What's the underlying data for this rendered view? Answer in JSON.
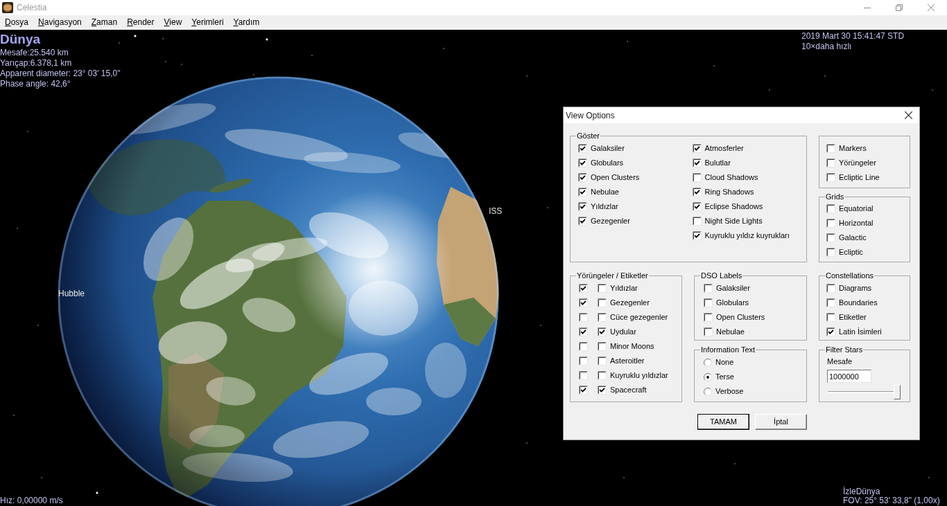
{
  "window": {
    "title": "Celestia"
  },
  "menu": [
    "Dosya",
    "Navigasyon",
    "Zaman",
    "Render",
    "View",
    "Yerimleri",
    "Yardım"
  ],
  "hud": {
    "object_name": "Dünya",
    "details": [
      "Mesafe:25.540 km",
      "Yarıçap:6.378,1 km",
      "Apparent diameter: 23° 03' 15,0\"",
      "Phase angle: 42,6°"
    ],
    "date_time": "2019 Mart 30 15:41:47 STD",
    "time_rate": "10×daha hızlı",
    "speed": "Hız: 0,00000 m/s",
    "tracking": "İzleDünya",
    "fov": "FOV: 25° 53' 33,8\" (1,00x)"
  },
  "scene_labels": [
    {
      "text": "ISS"
    },
    {
      "text": "Hubble"
    }
  ],
  "view_options": {
    "title": "View Options",
    "show": {
      "title": "Göster",
      "columns": [
        {
          "items": [
            {
              "label": "Galaksiler",
              "checked": true
            },
            {
              "label": "Globulars",
              "checked": true
            },
            {
              "label": "Open Clusters",
              "checked": true
            },
            {
              "label": "Nebulae",
              "checked": true
            },
            {
              "label": "Yıldızlar",
              "checked": true
            },
            {
              "label": "Gezegenler",
              "checked": true
            }
          ]
        },
        {
          "items": [
            {
              "label": "Atmosferler",
              "checked": true
            },
            {
              "label": "Bulutlar",
              "checked": true
            },
            {
              "label": "Cloud Shadows",
              "checked": false
            },
            {
              "label": "Ring Shadows",
              "checked": true
            },
            {
              "label": "Eclipse Shadows",
              "checked": true
            },
            {
              "label": "Night Side Lights",
              "checked": false
            },
            {
              "label": "Kuyruklu yıldız kuyrukları",
              "checked": true
            }
          ]
        }
      ]
    },
    "untitled_group": {
      "items": [
        {
          "label": "Markers",
          "checked": false
        },
        {
          "label": "Yörüngeler",
          "checked": false
        },
        {
          "label": "Ecliptic Line",
          "checked": false
        }
      ]
    },
    "grids": {
      "title": "Grids",
      "items": [
        {
          "label": "Equatorial",
          "checked": false
        },
        {
          "label": "Horizontal",
          "checked": false
        },
        {
          "label": "Galactic",
          "checked": false
        },
        {
          "label": "Ecliptic",
          "checked": false
        }
      ]
    },
    "orbits_labels": {
      "title": "Yörüngeler / Etiketler",
      "rows": [
        {
          "label": "Yıldızlar",
          "orbit_checked": true,
          "label_checked": false
        },
        {
          "label": "Gezegenler",
          "orbit_checked": true,
          "label_checked": false
        },
        {
          "label": "Cüce gezegenler",
          "orbit_checked": false,
          "label_checked": false
        },
        {
          "label": "Uydular",
          "orbit_checked": true,
          "label_checked": true
        },
        {
          "label": "Minor Moons",
          "orbit_checked": false,
          "label_checked": false
        },
        {
          "label": "Asteroitler",
          "orbit_checked": false,
          "label_checked": false
        },
        {
          "label": "Kuyruklu yıldızlar",
          "orbit_checked": false,
          "label_checked": false
        },
        {
          "label": "Spacecraft",
          "orbit_checked": true,
          "label_checked": true
        }
      ]
    },
    "dso_labels": {
      "title": "DSO Labels",
      "items": [
        {
          "label": "Galaksiler",
          "checked": false
        },
        {
          "label": "Globulars",
          "checked": false
        },
        {
          "label": "Open Clusters",
          "checked": false
        },
        {
          "label": "Nebulae",
          "checked": false
        }
      ]
    },
    "information_text": {
      "title": "Information Text",
      "options": [
        {
          "label": "None",
          "selected": false
        },
        {
          "label": "Terse",
          "selected": true
        },
        {
          "label": "Verbose",
          "selected": false
        }
      ]
    },
    "constellations": {
      "title": "Constellations",
      "items": [
        {
          "label": "Diagrams",
          "checked": false
        },
        {
          "label": "Boundaries",
          "checked": false
        },
        {
          "label": "Etiketler",
          "checked": false
        },
        {
          "label": "Latin İsimleri",
          "checked": true
        }
      ]
    },
    "filter_stars": {
      "title": "Filter Stars",
      "field_label": "Mesafe",
      "value": "1000000",
      "level": 1
    },
    "buttons": [
      {
        "label": "TAMAM",
        "default": true
      },
      {
        "label": "İptal",
        "default": false
      }
    ]
  }
}
